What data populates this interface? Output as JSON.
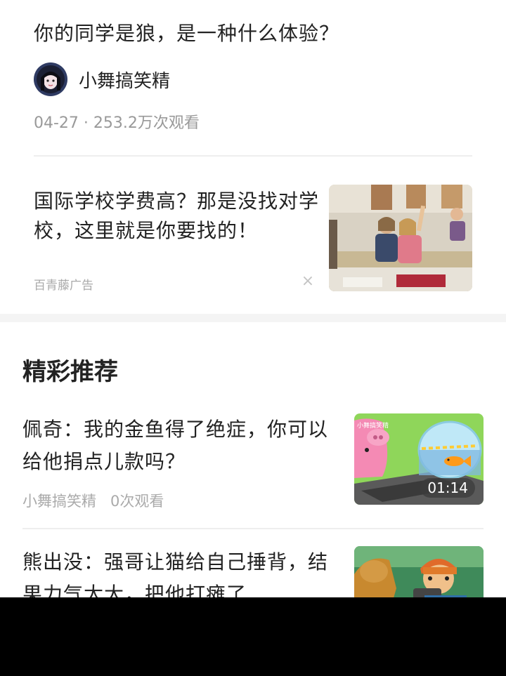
{
  "video": {
    "title": "你的同学是狼，是一种什么体验？",
    "author": "小舞搞笑精",
    "meta": "04-27 · 253.2万次观看"
  },
  "ad": {
    "title": "国际学校学费高？那是没找对学校，这里就是你要找的！",
    "source": "百青藤广告",
    "close_symbol": "×"
  },
  "recommend": {
    "section_title": "精彩推荐",
    "items": [
      {
        "title": "佩奇：我的金鱼得了绝症，你可以给他捐点儿款吗？",
        "author": "小舞搞笑精",
        "views": "0次观看",
        "duration": "01:14",
        "thumb_watermark": "小舞搞笑精"
      },
      {
        "title": "熊出没：强哥让猫给自己捶背，结果力气太大，把他打瘫了"
      }
    ]
  },
  "colors": {
    "text_primary": "#222222",
    "text_secondary": "#999999",
    "divider": "#eeeeee",
    "section_gap": "#f4f4f4"
  }
}
